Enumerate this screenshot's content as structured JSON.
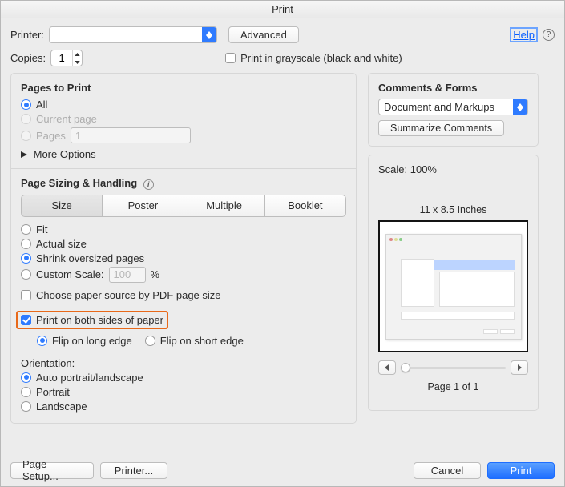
{
  "title": "Print",
  "header": {
    "printer_label": "Printer:",
    "printer_value": "",
    "advanced": "Advanced",
    "help": "Help",
    "copies_label": "Copies:",
    "copies_value": "1",
    "grayscale": "Print in grayscale (black and white)"
  },
  "pages": {
    "heading": "Pages to Print",
    "all": "All",
    "current": "Current page",
    "pages_label": "Pages",
    "pages_value": "1",
    "more_options": "More Options"
  },
  "sizing": {
    "heading": "Page Sizing & Handling",
    "seg": {
      "size": "Size",
      "poster": "Poster",
      "multiple": "Multiple",
      "booklet": "Booklet"
    },
    "fit": "Fit",
    "actual": "Actual size",
    "shrink": "Shrink oversized pages",
    "custom_label": "Custom Scale:",
    "custom_value": "100",
    "custom_unit": "%",
    "pdf_source": "Choose paper source by PDF page size",
    "both_sides": "Print on both sides of paper",
    "flip_long": "Flip on long edge",
    "flip_short": "Flip on short edge",
    "orientation_label": "Orientation:",
    "orient_auto": "Auto portrait/landscape",
    "orient_portrait": "Portrait",
    "orient_landscape": "Landscape"
  },
  "comments": {
    "heading": "Comments & Forms",
    "select_value": "Document and Markups",
    "summarize": "Summarize Comments"
  },
  "preview": {
    "scale_text": "Scale: 100%",
    "paper_size": "11 x 8.5 Inches",
    "page_readout": "Page 1 of 1"
  },
  "footer": {
    "page_setup": "Page Setup...",
    "printer_btn": "Printer...",
    "cancel": "Cancel",
    "print": "Print"
  }
}
